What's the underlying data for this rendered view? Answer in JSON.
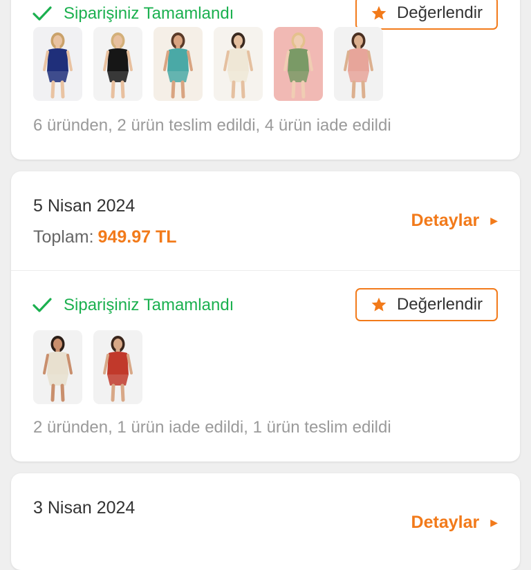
{
  "colors": {
    "accent": "#f27a1a",
    "success": "#1bb04f",
    "text": "#333333",
    "muted": "#9a9a9a"
  },
  "labels": {
    "total": "Toplam:",
    "details": "Detaylar",
    "rate": "Değerlendir"
  },
  "icons": {
    "status": "checkmark-icon",
    "rate": "star-icon",
    "details": "caret-right-icon"
  },
  "orders": [
    {
      "status": "Siparişiniz Tamamlandı",
      "summary": "6 üründen, 2 ürün teslim edildi, 4 ürün iade edildi",
      "products": [
        {
          "image": "navy-knit-dress-photo",
          "skin": "#e9c3a2",
          "hair": "#caa26a",
          "outfit": "#1f2f7a",
          "bg": "#f1f1f3"
        },
        {
          "image": "black-knit-dress-photo",
          "skin": "#e8c09f",
          "hair": "#d3b07a",
          "outfit": "#161616",
          "bg": "#f3f3f3"
        },
        {
          "image": "floral-shirt-set-photo",
          "skin": "#d9a481",
          "hair": "#5a3a28",
          "outfit": "#4aa9a6",
          "bg": "#f5efe7"
        },
        {
          "image": "cream-crochet-top-photo",
          "skin": "#e5c0a0",
          "hair": "#3a2a20",
          "outfit": "#efe7d6",
          "bg": "#f6f3ee"
        },
        {
          "image": "floral-skirt-photo",
          "skin": "#f0cdb3",
          "hair": "#e4c18d",
          "outfit": "#7a9a66",
          "bg": "#f1b9b4"
        },
        {
          "image": "floral-shorts-photo",
          "skin": "#dcb08f",
          "hair": "#4a3022",
          "outfit": "#e7a59a",
          "bg": "#f2f2f2"
        }
      ]
    },
    {
      "date": "5 Nisan 2024",
      "total": "949.97 TL",
      "status": "Siparişiniz Tamamlandı",
      "summary": "2 üründen, 1 ürün iade edildi, 1 ürün teslim edildi",
      "products": [
        {
          "image": "beige-vest-set-photo",
          "skin": "#c98f6d",
          "hair": "#2b1e17",
          "outfit": "#e8e0cf",
          "bg": "#f2f2f2"
        },
        {
          "image": "red-button-dress-photo",
          "skin": "#d8a887",
          "hair": "#3a261c",
          "outfit": "#c1392b",
          "bg": "#f2f2f2"
        }
      ]
    },
    {
      "date": "3 Nisan 2024"
    }
  ]
}
